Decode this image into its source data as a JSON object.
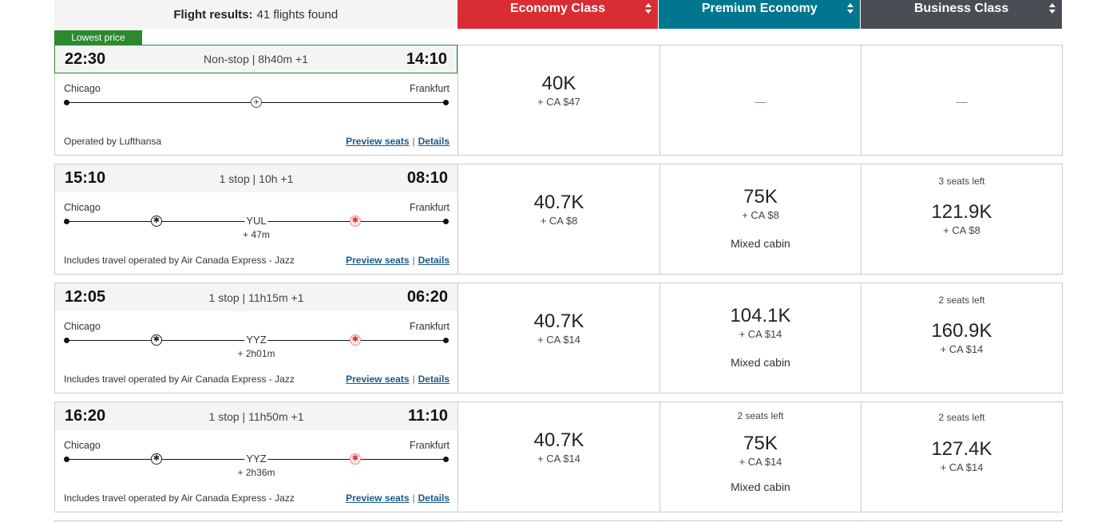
{
  "header": {
    "title_label": "Flight results:",
    "title_count": "41 flights found",
    "cabins": [
      {
        "label": "Economy Class",
        "color": "#d92d33"
      },
      {
        "label": "Premium Economy",
        "color": "#00778e"
      },
      {
        "label": "Business Class",
        "color": "#4a4d53"
      }
    ]
  },
  "badge": {
    "label": "Lowest price",
    "color": "#2b8a2e"
  },
  "flights": [
    {
      "depart": "22:30",
      "arrive": "14:10",
      "summary": "Non-stop | 8h40m +1",
      "origin": "Chicago",
      "destination": "Frankfurt",
      "stop_code": "",
      "layover": "",
      "operator": "Operated by Lufthansa",
      "preview_label": "Preview seats",
      "details_label": "Details",
      "separator": "|",
      "economy": {
        "seats": "",
        "points": "40K",
        "taxes": "+ CA $47",
        "note": ""
      },
      "premium": {
        "dash": "—"
      },
      "business": {
        "dash": "—"
      }
    },
    {
      "depart": "15:10",
      "arrive": "08:10",
      "summary": "1 stop | 10h +1",
      "origin": "Chicago",
      "destination": "Frankfurt",
      "stop_code": "YUL",
      "layover": "+ 47m",
      "operator": "Includes travel operated by Air Canada Express - Jazz",
      "preview_label": "Preview seats",
      "details_label": "Details",
      "separator": "|",
      "economy": {
        "seats": "",
        "points": "40.7K",
        "taxes": "+ CA $8",
        "note": ""
      },
      "premium": {
        "seats": "",
        "points": "75K",
        "taxes": "+ CA $8",
        "note": "Mixed cabin"
      },
      "business": {
        "seats": "3 seats left",
        "points": "121.9K",
        "taxes": "+ CA $8",
        "note": ""
      }
    },
    {
      "depart": "12:05",
      "arrive": "06:20",
      "summary": "1 stop | 11h15m +1",
      "origin": "Chicago",
      "destination": "Frankfurt",
      "stop_code": "YYZ",
      "layover": "+ 2h01m",
      "operator": "Includes travel operated by Air Canada Express - Jazz",
      "preview_label": "Preview seats",
      "details_label": "Details",
      "separator": "|",
      "economy": {
        "seats": "",
        "points": "40.7K",
        "taxes": "+ CA $14",
        "note": ""
      },
      "premium": {
        "seats": "",
        "points": "104.1K",
        "taxes": "+ CA $14",
        "note": "Mixed cabin"
      },
      "business": {
        "seats": "2 seats left",
        "points": "160.9K",
        "taxes": "+ CA $14",
        "note": ""
      }
    },
    {
      "depart": "16:20",
      "arrive": "11:10",
      "summary": "1 stop | 11h50m +1",
      "origin": "Chicago",
      "destination": "Frankfurt",
      "stop_code": "YYZ",
      "layover": "+ 2h36m",
      "operator": "Includes travel operated by Air Canada Express - Jazz",
      "preview_label": "Preview seats",
      "details_label": "Details",
      "separator": "|",
      "economy": {
        "seats": "",
        "points": "40.7K",
        "taxes": "+ CA $14",
        "note": ""
      },
      "premium": {
        "seats": "2 seats left",
        "points": "75K",
        "taxes": "+ CA $14",
        "note": "Mixed cabin"
      },
      "business": {
        "seats": "2 seats left",
        "points": "127.4K",
        "taxes": "+ CA $14",
        "note": ""
      }
    }
  ],
  "icons": {
    "lufthansa": "✈",
    "air_canada": "✱"
  }
}
